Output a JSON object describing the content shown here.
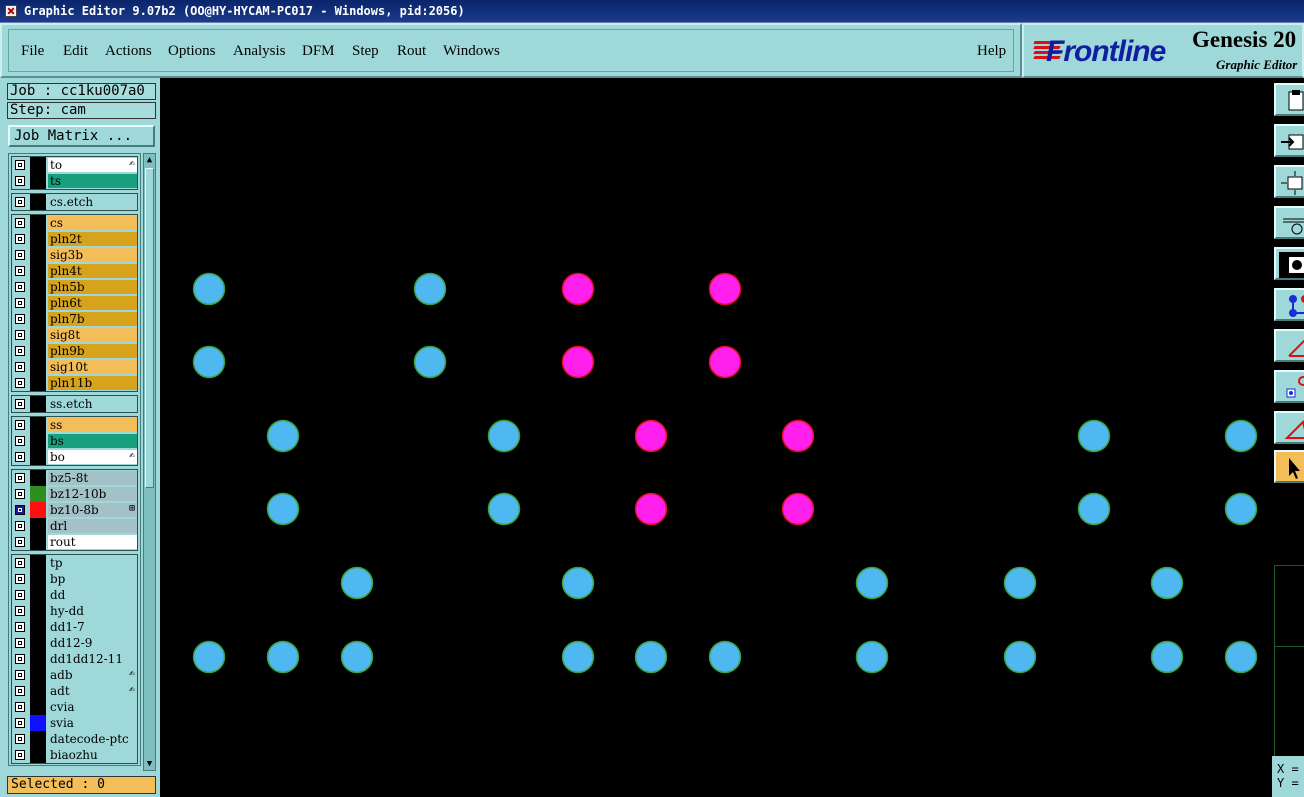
{
  "window": {
    "title": "Graphic Editor 9.07b2 (OO@HY-HYCAM-PC017 - Windows, pid:2056)"
  },
  "menu": {
    "items": [
      "File",
      "Edit",
      "Actions",
      "Options",
      "Analysis",
      "DFM",
      "Step",
      "Rout",
      "Windows"
    ],
    "help": "Help"
  },
  "logo": {
    "brand": "Frontline",
    "product": "Genesis 20",
    "subtitle": "Graphic Editor"
  },
  "job": {
    "job_line": "Job : cc1ku007a0",
    "step_line": "Step: cam",
    "matrix_button": "Job Matrix ..."
  },
  "colors": {
    "panel": "#9fd8d9",
    "orange": "#d7a31c",
    "yellow": "#f3bd5a",
    "green": "#17a07e",
    "gray": "#a4c1c8",
    "white": "#ffffff",
    "blue_pad": "#4fb8f0",
    "magenta_pad": "#ff20ee"
  },
  "layer_groups": [
    {
      "layers": [
        {
          "name": "to",
          "color": "white",
          "mark": "✍"
        },
        {
          "name": "ts",
          "color": "green"
        }
      ]
    },
    {
      "layers": [
        {
          "name": "cs.etch",
          "color": "panel"
        }
      ]
    },
    {
      "layers": [
        {
          "name": "cs",
          "color": "yellow"
        },
        {
          "name": "pln2t",
          "color": "orange"
        },
        {
          "name": "sig3b",
          "color": "yellow"
        },
        {
          "name": "pln4t",
          "color": "orange"
        },
        {
          "name": "pln5b",
          "color": "orange"
        },
        {
          "name": "pln6t",
          "color": "orange"
        },
        {
          "name": "pln7b",
          "color": "orange"
        },
        {
          "name": "sig8t",
          "color": "yellow"
        },
        {
          "name": "pln9b",
          "color": "orange"
        },
        {
          "name": "sig10t",
          "color": "yellow"
        },
        {
          "name": "pln11b",
          "color": "orange"
        }
      ]
    },
    {
      "layers": [
        {
          "name": "ss.etch",
          "color": "panel"
        }
      ]
    },
    {
      "layers": [
        {
          "name": "ss",
          "color": "yellow"
        },
        {
          "name": "bs",
          "color": "green"
        },
        {
          "name": "bo",
          "color": "white",
          "mark": "✍"
        }
      ]
    },
    {
      "layers": [
        {
          "name": "bz5-8t",
          "color": "gray"
        },
        {
          "name": "bz12-10b",
          "color": "gray",
          "swatch": "#2e8f1e"
        },
        {
          "name": "bz10-8b",
          "color": "gray",
          "swatch": "#ff1010",
          "selected": true,
          "mark": "⊞"
        },
        {
          "name": "drl",
          "color": "gray"
        },
        {
          "name": "rout",
          "color": "white"
        }
      ]
    },
    {
      "layers": [
        {
          "name": "tp",
          "color": "panel"
        },
        {
          "name": "bp",
          "color": "panel"
        },
        {
          "name": "dd",
          "color": "panel"
        },
        {
          "name": "hy-dd",
          "color": "panel"
        },
        {
          "name": "dd1-7",
          "color": "panel"
        },
        {
          "name": "dd12-9",
          "color": "panel"
        },
        {
          "name": "dd1dd12-11",
          "color": "panel"
        },
        {
          "name": "adb",
          "color": "panel",
          "mark": "✍"
        },
        {
          "name": "adt",
          "color": "panel",
          "mark": "✍"
        },
        {
          "name": "cvia",
          "color": "panel"
        },
        {
          "name": "svia",
          "color": "panel",
          "swatch": "#1010ff"
        },
        {
          "name": "datecode-ptc",
          "color": "panel"
        },
        {
          "name": "biaozhu",
          "color": "panel"
        }
      ]
    }
  ],
  "status": {
    "selected": "Selected : 0"
  },
  "coords": {
    "x_label": "X =",
    "y_label": "Y ="
  },
  "toolbar_icons": [
    "clipboard-icon",
    "snap-icon",
    "fit-icon",
    "measure-icon",
    "pad-icon",
    "net-icon",
    "angle-icon",
    "feature-icon",
    "triangle-icon",
    "pointer-icon"
  ],
  "pads": {
    "blue": [
      [
        "a",
        "r1"
      ],
      [
        "c",
        "r1"
      ],
      [
        "a",
        "r2"
      ],
      [
        "c",
        "r2"
      ],
      [
        "b",
        "r3"
      ],
      [
        "d",
        "r3"
      ],
      [
        "m",
        "r3"
      ],
      [
        "o",
        "r3"
      ],
      [
        "b",
        "r4"
      ],
      [
        "d",
        "r4"
      ],
      [
        "m",
        "r4"
      ],
      [
        "o",
        "r4"
      ],
      [
        "h",
        "r5"
      ],
      [
        "e",
        "r5"
      ],
      [
        "k",
        "r5"
      ],
      [
        "l",
        "r5"
      ],
      [
        "n",
        "r5"
      ],
      [
        "a",
        "r6"
      ],
      [
        "b",
        "r6"
      ],
      [
        "h",
        "r6"
      ],
      [
        "e",
        "r6"
      ],
      [
        "f",
        "r6"
      ],
      [
        "g",
        "r6"
      ],
      [
        "k",
        "r6"
      ],
      [
        "l",
        "r6"
      ],
      [
        "n",
        "r6"
      ],
      [
        "o",
        "r6"
      ]
    ],
    "magenta": [
      [
        "p",
        "r1"
      ],
      [
        "g",
        "r1"
      ],
      [
        "p",
        "r2"
      ],
      [
        "g",
        "r2"
      ],
      [
        "f",
        "r3"
      ],
      [
        "q",
        "r3"
      ],
      [
        "f",
        "r4"
      ],
      [
        "q",
        "r4"
      ]
    ]
  }
}
